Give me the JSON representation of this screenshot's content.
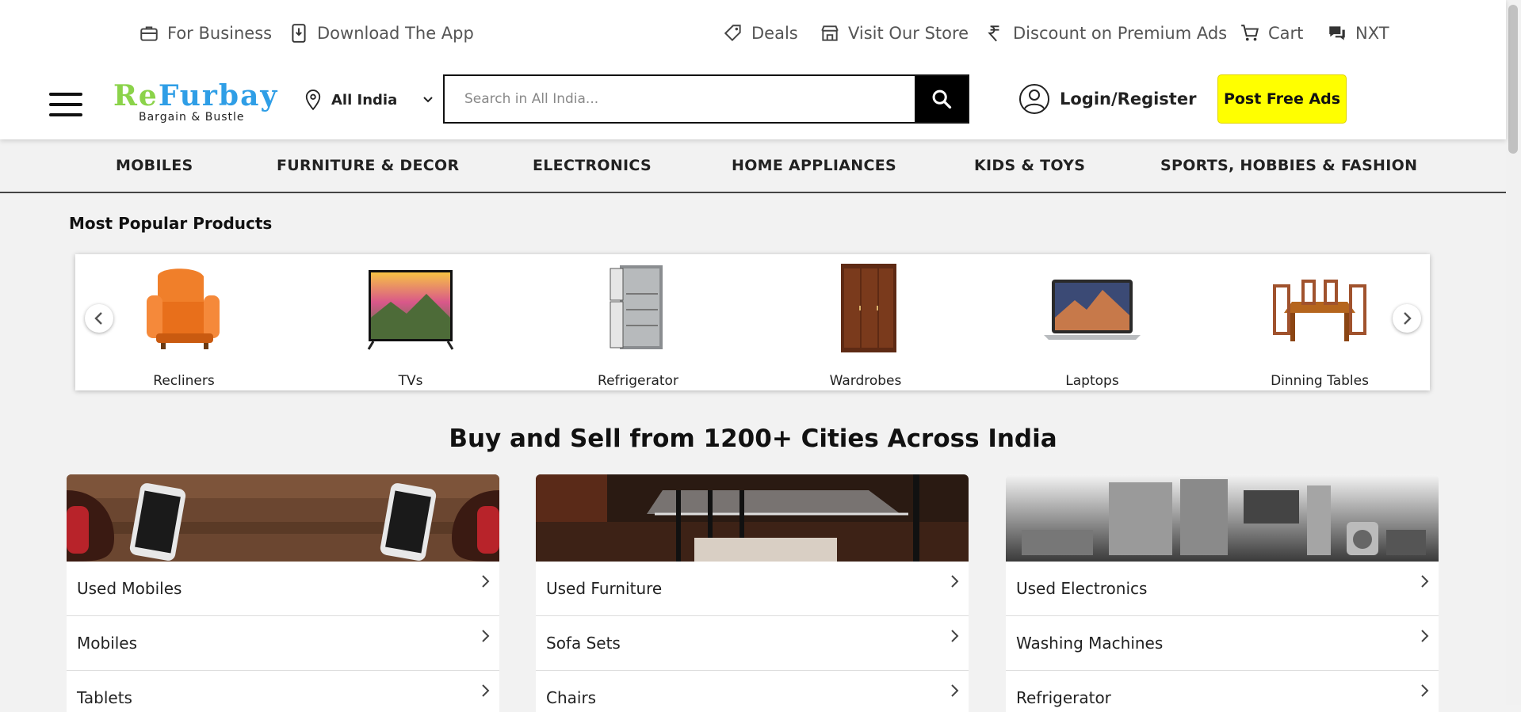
{
  "topbar": {
    "for_business": "For Business",
    "download_app": "Download The App",
    "deals": "Deals",
    "visit_store": "Visit Our Store",
    "discount": "Discount on Premium Ads",
    "cart": "Cart",
    "nxt": "NXT"
  },
  "header": {
    "logo_re": "Re",
    "logo_furbay": "Furbay",
    "logo_tagline": "Bargain & Bustle",
    "location": "All India",
    "search_placeholder": "Search in All India...",
    "login": "Login/Register",
    "post_ads": "Post Free Ads"
  },
  "catnav": [
    "MOBILES",
    "FURNITURE & DECOR",
    "ELECTRONICS",
    "HOME APPLIANCES",
    "KIDS & TOYS",
    "SPORTS, HOBBIES & FASHION"
  ],
  "popular": {
    "title": "Most Popular Products",
    "items": [
      "Recliners",
      "TVs",
      "Refrigerator",
      "Wardrobes",
      "Laptops",
      "Dinning Tables"
    ]
  },
  "main_heading": "Buy and Sell from 1200+ Cities Across India",
  "cards": [
    {
      "rows": [
        "Used Mobiles",
        "Mobiles",
        "Tablets"
      ]
    },
    {
      "rows": [
        "Used Furniture",
        "Sofa Sets",
        "Chairs"
      ]
    },
    {
      "rows": [
        "Used Electronics",
        "Washing Machines",
        "Refrigerator"
      ]
    }
  ],
  "colors": {
    "accent_yellow": "#ffff00",
    "logo_green": "#8bd34a",
    "logo_blue": "#2f9ee6",
    "page_bg": "#f2f2f2"
  }
}
